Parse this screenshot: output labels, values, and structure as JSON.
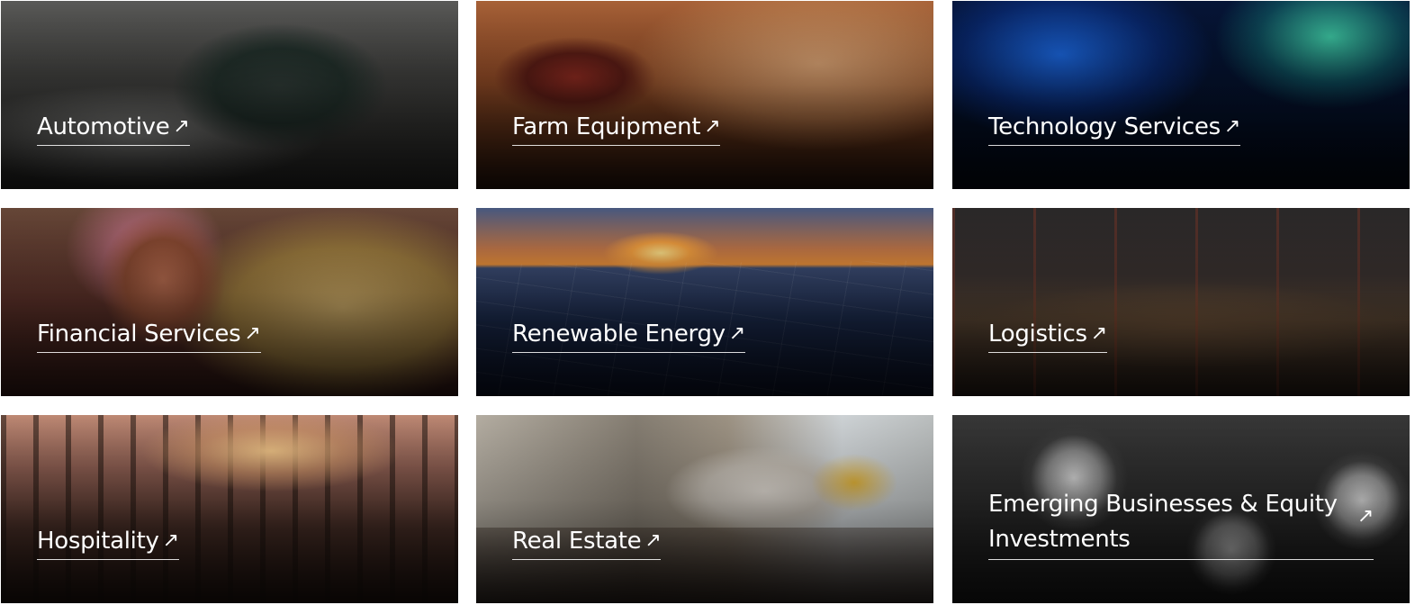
{
  "tiles": [
    {
      "label": "Automotive",
      "arrow": "↗"
    },
    {
      "label": "Farm Equipment",
      "arrow": "↗"
    },
    {
      "label": "Technology Services",
      "arrow": "↗"
    },
    {
      "label": "Financial Services",
      "arrow": "↗"
    },
    {
      "label": "Renewable Energy",
      "arrow": "↗"
    },
    {
      "label": "Logistics",
      "arrow": "↗"
    },
    {
      "label": "Hospitality",
      "arrow": "↗"
    },
    {
      "label": "Real Estate",
      "arrow": "↗"
    },
    {
      "label": "Emerging Businesses & Equity Investments",
      "arrow": "↗"
    }
  ]
}
